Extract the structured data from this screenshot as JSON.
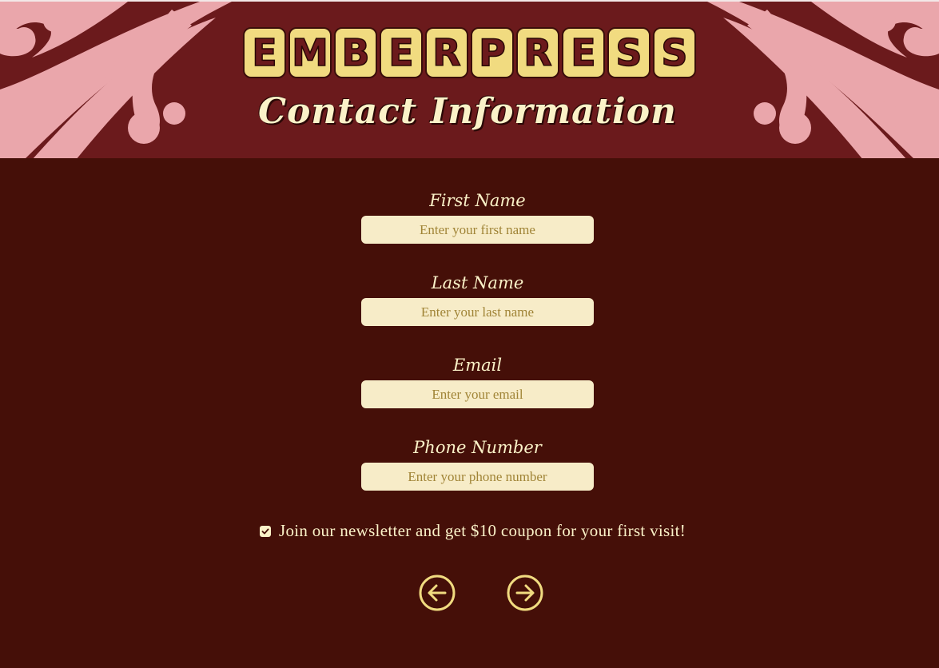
{
  "brand": {
    "letters": [
      "E",
      "M",
      "B",
      "E",
      "R",
      "P",
      "R",
      "E",
      "S",
      "S"
    ]
  },
  "page": {
    "title": "Contact Information"
  },
  "form": {
    "first_name": {
      "label": "First Name",
      "placeholder": "Enter your first name",
      "value": ""
    },
    "last_name": {
      "label": "Last Name",
      "placeholder": "Enter your last name",
      "value": ""
    },
    "email": {
      "label": "Email",
      "placeholder": "Enter your email",
      "value": ""
    },
    "phone": {
      "label": "Phone Number",
      "placeholder": "Enter your phone number",
      "value": ""
    },
    "newsletter": {
      "label": "Join our newsletter and get $10 coupon for your first visit!",
      "checked": true
    }
  },
  "nav": {
    "back_icon": "arrow-left-circle-icon",
    "next_icon": "arrow-right-circle-icon"
  },
  "colors": {
    "header_bg": "#6b1a1c",
    "body_bg": "#450f08",
    "accent": "#f1db80",
    "swirl": "#eaa6ab",
    "text": "#fbf2c8",
    "input_bg": "#f7ecc8",
    "placeholder": "#a08436"
  }
}
